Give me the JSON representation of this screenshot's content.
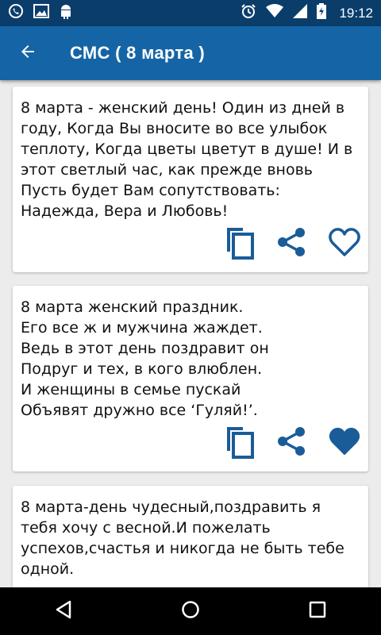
{
  "status_bar": {
    "time": "19:12",
    "icons": [
      "viber-icon",
      "image-icon",
      "android-icon",
      "alarm-icon",
      "wifi-icon",
      "signal-icon",
      "battery-charging-icon"
    ]
  },
  "app_bar": {
    "title": "СМС ( 8 марта )",
    "back_icon": "arrow-back-icon"
  },
  "colors": {
    "status_bar": "#0b3d6b",
    "app_bar": "#1565a6",
    "accent": "#1a5c98",
    "background": "#ececec",
    "nav_bar": "#000000"
  },
  "cards": [
    {
      "text": "8 марта - женский день! Один из дней в году, Когда Вы вносите во все улыбок теплоту, Когда цветы цветут в душе! И в этот светлый час, как прежде вновь Пусть будет Вам сопутствовать: Надежда, Вера и Любовь!",
      "favorite": false
    },
    {
      "text": "8 марта женский праздник.\nЕго все ж и мужчина жаждет.\nВедь в этот день поздравит он\nПодруг и тех, в кого влюблен.\nИ женщины в семье пускай\nОбъявят дружно все ‘Гуляй!’.",
      "favorite": true
    },
    {
      "text": "8 марта-день чудесный,поздравить я тебя хочу с весной.И пожелать успехов,счастья и никогда не быть тебе одной.",
      "favorite": false
    }
  ],
  "nav_bar": {
    "icons": [
      "back-triangle-icon",
      "home-circle-icon",
      "recents-square-icon"
    ]
  }
}
